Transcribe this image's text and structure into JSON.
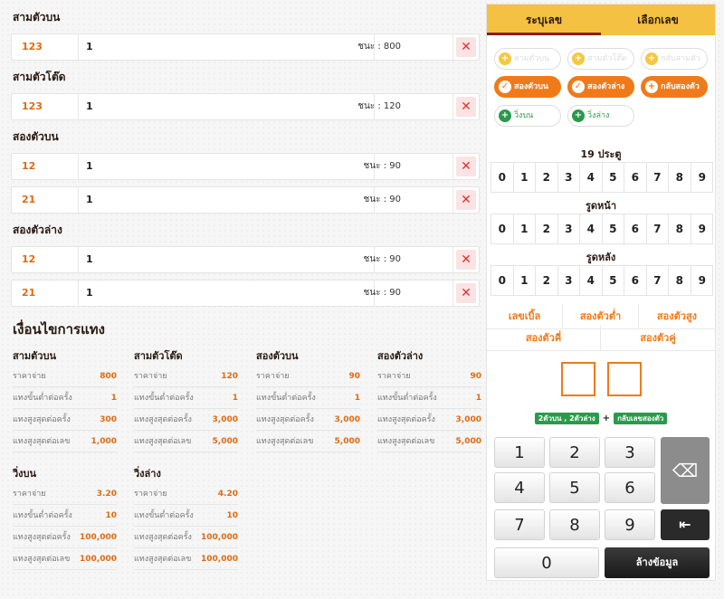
{
  "bets": [
    {
      "title": "สามตัวบน",
      "rows": [
        {
          "number": "123",
          "amount": "1",
          "win": "ชนะ : 800"
        }
      ]
    },
    {
      "title": "สามตัวโต๊ด",
      "rows": [
        {
          "number": "123",
          "amount": "1",
          "win": "ชนะ : 120"
        }
      ]
    },
    {
      "title": "สองตัวบน",
      "rows": [
        {
          "number": "12",
          "amount": "1",
          "win": "ชนะ : 90"
        },
        {
          "number": "21",
          "amount": "1",
          "win": "ชนะ : 90"
        }
      ]
    },
    {
      "title": "สองตัวล่าง",
      "rows": [
        {
          "number": "12",
          "amount": "1",
          "win": "ชนะ : 90"
        },
        {
          "number": "21",
          "amount": "1",
          "win": "ชนะ : 90"
        }
      ]
    }
  ],
  "delete_glyph": "✕",
  "conditions": {
    "heading": "เงื่อนไขการแทง",
    "blocks": [
      {
        "title": "สามตัวบน",
        "rows": [
          {
            "label": "ราคาจ่าย",
            "value": "800"
          },
          {
            "label": "แทงขั้นต่ำต่อครั้ง",
            "value": "1"
          },
          {
            "label": "แทงสูงสุดต่อครั้ง",
            "value": "300"
          },
          {
            "label": "แทงสูงสุดต่อเลข",
            "value": "1,000"
          }
        ]
      },
      {
        "title": "สามตัวโต๊ด",
        "rows": [
          {
            "label": "ราคาจ่าย",
            "value": "120"
          },
          {
            "label": "แทงขั้นต่ำต่อครั้ง",
            "value": "1"
          },
          {
            "label": "แทงสูงสุดต่อครั้ง",
            "value": "3,000"
          },
          {
            "label": "แทงสูงสุดต่อเลข",
            "value": "5,000"
          }
        ]
      },
      {
        "title": "สองตัวบน",
        "rows": [
          {
            "label": "ราคาจ่าย",
            "value": "90"
          },
          {
            "label": "แทงขั้นต่ำต่อครั้ง",
            "value": "1"
          },
          {
            "label": "แทงสูงสุดต่อครั้ง",
            "value": "3,000"
          },
          {
            "label": "แทงสูงสุดต่อเลข",
            "value": "5,000"
          }
        ]
      },
      {
        "title": "สองตัวล่าง",
        "rows": [
          {
            "label": "ราคาจ่าย",
            "value": "90"
          },
          {
            "label": "แทงขั้นต่ำต่อครั้ง",
            "value": "1"
          },
          {
            "label": "แทงสูงสุดต่อครั้ง",
            "value": "3,000"
          },
          {
            "label": "แทงสูงสุดต่อเลข",
            "value": "5,000"
          }
        ]
      },
      {
        "title": "วิ่งบน",
        "rows": [
          {
            "label": "ราคาจ่าย",
            "value": "3.20"
          },
          {
            "label": "แทงขั้นต่ำต่อครั้ง",
            "value": "10"
          },
          {
            "label": "แทงสูงสุดต่อครั้ง",
            "value": "100,000"
          },
          {
            "label": "แทงสูงสุดต่อเลข",
            "value": "100,000"
          }
        ]
      },
      {
        "title": "วิ่งล่าง",
        "rows": [
          {
            "label": "ราคาจ่าย",
            "value": "4.20"
          },
          {
            "label": "แทงขั้นต่ำต่อครั้ง",
            "value": "10"
          },
          {
            "label": "แทงสูงสุดต่อครั้ง",
            "value": "100,000"
          },
          {
            "label": "แทงสูงสุดต่อเลข",
            "value": "100,000"
          }
        ]
      }
    ]
  },
  "panel": {
    "tabs": [
      {
        "label": "ระบุเลข",
        "active": true
      },
      {
        "label": "เลือกเลข",
        "active": false
      }
    ],
    "types": [
      {
        "label": "สามตัวบน",
        "state": "disabled",
        "icon": "plus"
      },
      {
        "label": "สามตัวโต๊ด",
        "state": "disabled",
        "icon": "plus"
      },
      {
        "label": "กลับสามตัว",
        "state": "disabled",
        "icon": "plus"
      },
      {
        "label": "สองตัวบน",
        "state": "selected",
        "icon": "check"
      },
      {
        "label": "สองตัวล่าง",
        "state": "selected",
        "icon": "check"
      },
      {
        "label": "กลับสองตัว",
        "state": "selected",
        "icon": "plus"
      },
      {
        "label": "วิ่งบน",
        "state": "available",
        "icon": "plus"
      },
      {
        "label": "วิ่งล่าง",
        "state": "available",
        "icon": "plus"
      }
    ],
    "digit_groups": [
      {
        "title": "19 ประตู",
        "digits": [
          "0",
          "1",
          "2",
          "3",
          "4",
          "5",
          "6",
          "7",
          "8",
          "9"
        ]
      },
      {
        "title": "รูดหน้า",
        "digits": [
          "0",
          "1",
          "2",
          "3",
          "4",
          "5",
          "6",
          "7",
          "8",
          "9"
        ]
      },
      {
        "title": "รูดหลัง",
        "digits": [
          "0",
          "1",
          "2",
          "3",
          "4",
          "5",
          "6",
          "7",
          "8",
          "9"
        ]
      }
    ],
    "options_row1": [
      "เลขเบิ้ล",
      "สองตัวต่ำ",
      "สองตัวสูง"
    ],
    "options_row2": [
      "สองตัวคี่",
      "สองตัวคู่"
    ],
    "legend": {
      "left": "2ตัวบน , 2ตัวล่าง",
      "plus": "+",
      "right": "กลับเลขสองตัว"
    },
    "keypad": {
      "keys": [
        "1",
        "2",
        "3",
        "4",
        "5",
        "6",
        "7",
        "8",
        "9",
        "0"
      ],
      "backspace_glyph": "⌫",
      "back_glyph": "⇤",
      "clear_label": "ล้างข้อมูล"
    }
  }
}
